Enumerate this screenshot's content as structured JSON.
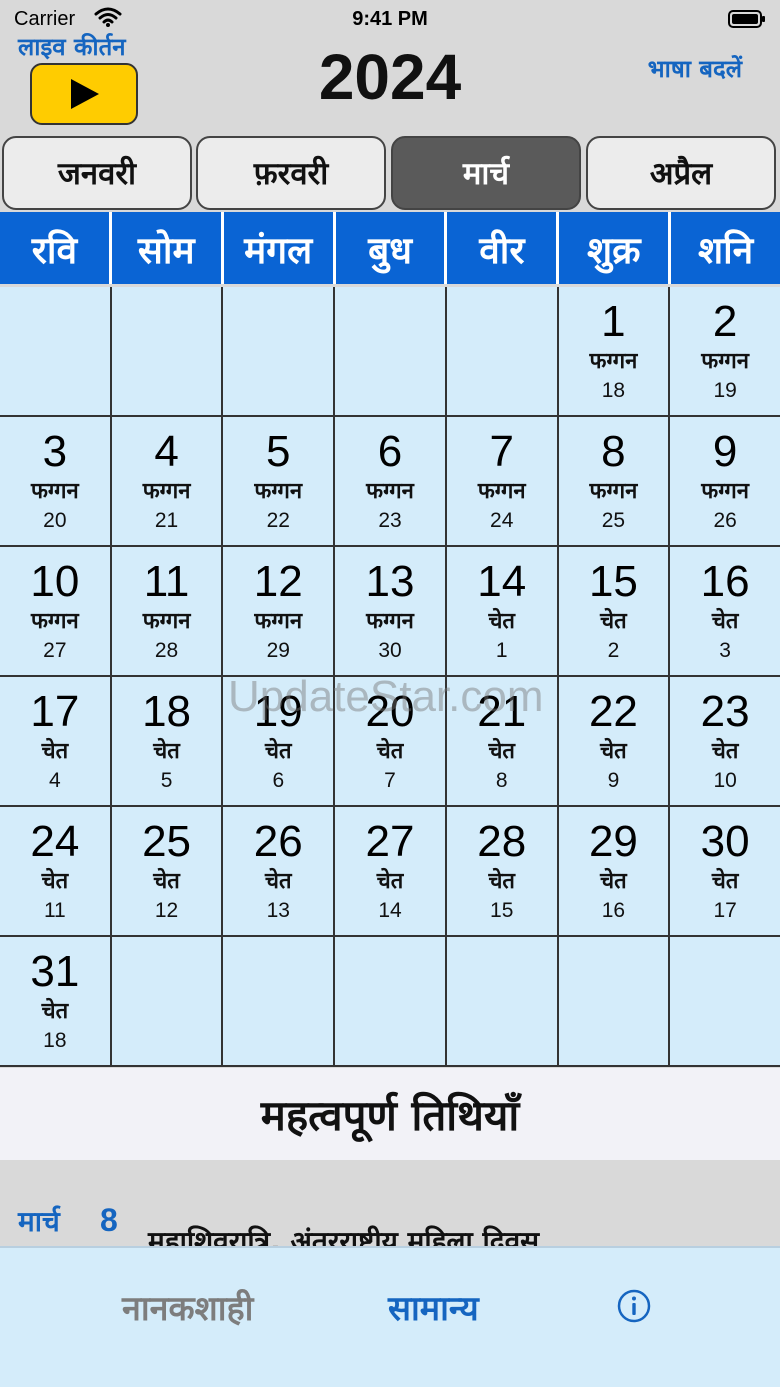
{
  "status_bar": {
    "carrier": "Carrier",
    "time": "9:41 PM"
  },
  "header": {
    "live_label": "लाइव कीर्तन",
    "year": "2024",
    "language_link": "भाषा बदलें"
  },
  "month_tabs": [
    {
      "label": "जनवरी",
      "active": false
    },
    {
      "label": "फ़रवरी",
      "active": false
    },
    {
      "label": "मार्च",
      "active": true
    },
    {
      "label": "अप्रैल",
      "active": false
    }
  ],
  "weekdays": [
    "रवि",
    "सोम",
    "मंगल",
    "बुध",
    "वीर",
    "शुक्र",
    "शनि"
  ],
  "calendar": {
    "leading_blanks": 5,
    "days": [
      {
        "day": "1",
        "month": "फग्गन",
        "date": "18"
      },
      {
        "day": "2",
        "month": "फग्गन",
        "date": "19"
      },
      {
        "day": "3",
        "month": "फग्गन",
        "date": "20"
      },
      {
        "day": "4",
        "month": "फग्गन",
        "date": "21"
      },
      {
        "day": "5",
        "month": "फग्गन",
        "date": "22"
      },
      {
        "day": "6",
        "month": "फग्गन",
        "date": "23"
      },
      {
        "day": "7",
        "month": "फग्गन",
        "date": "24"
      },
      {
        "day": "8",
        "month": "फग्गन",
        "date": "25"
      },
      {
        "day": "9",
        "month": "फग्गन",
        "date": "26"
      },
      {
        "day": "10",
        "month": "फग्गन",
        "date": "27"
      },
      {
        "day": "11",
        "month": "फग्गन",
        "date": "28"
      },
      {
        "day": "12",
        "month": "फग्गन",
        "date": "29"
      },
      {
        "day": "13",
        "month": "फग्गन",
        "date": "30"
      },
      {
        "day": "14",
        "month": "चेत",
        "date": "1"
      },
      {
        "day": "15",
        "month": "चेत",
        "date": "2"
      },
      {
        "day": "16",
        "month": "चेत",
        "date": "3"
      },
      {
        "day": "17",
        "month": "चेत",
        "date": "4"
      },
      {
        "day": "18",
        "month": "चेत",
        "date": "5"
      },
      {
        "day": "19",
        "month": "चेत",
        "date": "6"
      },
      {
        "day": "20",
        "month": "चेत",
        "date": "7"
      },
      {
        "day": "21",
        "month": "चेत",
        "date": "8"
      },
      {
        "day": "22",
        "month": "चेत",
        "date": "9"
      },
      {
        "day": "23",
        "month": "चेत",
        "date": "10"
      },
      {
        "day": "24",
        "month": "चेत",
        "date": "11"
      },
      {
        "day": "25",
        "month": "चेत",
        "date": "12"
      },
      {
        "day": "26",
        "month": "चेत",
        "date": "13"
      },
      {
        "day": "27",
        "month": "चेत",
        "date": "14"
      },
      {
        "day": "28",
        "month": "चेत",
        "date": "15"
      },
      {
        "day": "29",
        "month": "चेत",
        "date": "16"
      },
      {
        "day": "30",
        "month": "चेत",
        "date": "17"
      },
      {
        "day": "31",
        "month": "चेत",
        "date": "18"
      }
    ]
  },
  "watermark": "UpdateStar.com",
  "important_dates": {
    "title": "महत्वपूर्ण तिथियाँ",
    "event": {
      "month": "मार्च",
      "day": "8",
      "text": "महाशिवरात्रि, अंतरराष्ट्रीय महिला दिवस"
    }
  },
  "tab_bar": {
    "nanakshahi": "नानकशाही",
    "general": "सामान्य"
  },
  "icons": {
    "play": "play-icon",
    "info": "info-icon",
    "wifi": "wifi-icon",
    "battery": "battery-icon"
  },
  "colors": {
    "accent": "#1565c0",
    "weekday_bg": "#0a64d4",
    "cell_bg": "#d4ecfa",
    "play_bg": "#ffcc00"
  }
}
